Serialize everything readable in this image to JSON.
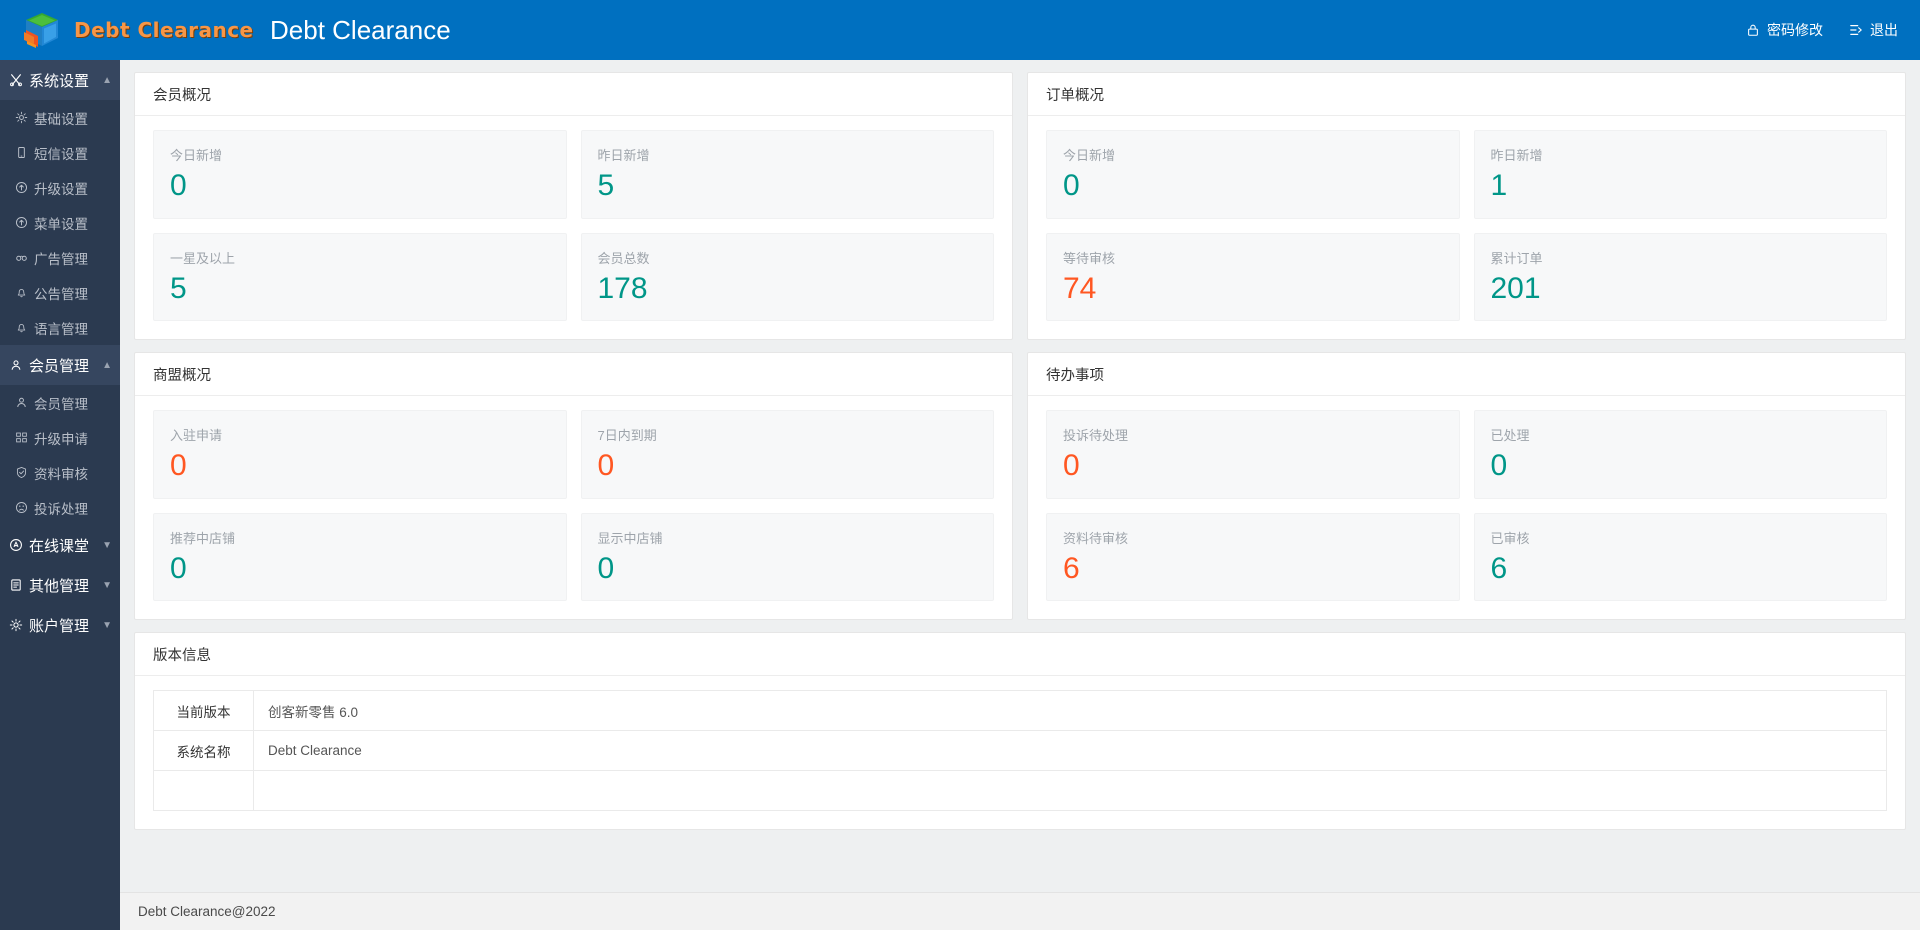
{
  "header": {
    "brand_word": "Debt Clearance",
    "logo_icon": "cube-logo-icon",
    "page_title": "Debt Clearance",
    "links": [
      {
        "label": "密码修改",
        "icon": "lock-icon"
      },
      {
        "label": "退出",
        "icon": "logout-icon"
      }
    ]
  },
  "sidebar": {
    "groups": [
      {
        "label": "系统设置",
        "icon": "scissors-icon",
        "expanded": true,
        "active": true,
        "chevron": "▲",
        "items": [
          {
            "label": "基础设置",
            "icon": "gear-icon"
          },
          {
            "label": "短信设置",
            "icon": "mobile-icon"
          },
          {
            "label": "升级设置",
            "icon": "up-circle-icon"
          },
          {
            "label": "菜单设置",
            "icon": "up-circle-icon"
          },
          {
            "label": "广告管理",
            "icon": "link-icon"
          },
          {
            "label": "公告管理",
            "icon": "bell-icon"
          },
          {
            "label": "语言管理",
            "icon": "bell-icon"
          }
        ]
      },
      {
        "label": "会员管理",
        "icon": "user-badge-icon",
        "expanded": true,
        "active": true,
        "chevron": "▲",
        "items": [
          {
            "label": "会员管理",
            "icon": "user-icon"
          },
          {
            "label": "升级申请",
            "icon": "grid-icon"
          },
          {
            "label": "资料审核",
            "icon": "shield-check-icon"
          },
          {
            "label": "投诉处理",
            "icon": "frown-icon"
          }
        ]
      },
      {
        "label": "在线课堂",
        "icon": "compass-icon",
        "expanded": false,
        "active": false,
        "chevron": "▼",
        "items": []
      },
      {
        "label": "其他管理",
        "icon": "file-icon",
        "expanded": false,
        "active": false,
        "chevron": "▼",
        "items": []
      },
      {
        "label": "账户管理",
        "icon": "gear-icon",
        "expanded": false,
        "active": false,
        "chevron": "▼",
        "items": []
      }
    ]
  },
  "panels": {
    "member_overview": {
      "title": "会员概况",
      "cards": [
        {
          "label": "今日新增",
          "value": "0",
          "color": "teal"
        },
        {
          "label": "昨日新增",
          "value": "5",
          "color": "teal"
        },
        {
          "label": "一星及以上",
          "value": "5",
          "color": "teal"
        },
        {
          "label": "会员总数",
          "value": "178",
          "color": "teal"
        }
      ]
    },
    "order_overview": {
      "title": "订单概况",
      "cards": [
        {
          "label": "今日新增",
          "value": "0",
          "color": "teal"
        },
        {
          "label": "昨日新增",
          "value": "1",
          "color": "teal"
        },
        {
          "label": "等待审核",
          "value": "74",
          "color": "orange"
        },
        {
          "label": "累计订单",
          "value": "201",
          "color": "teal"
        }
      ]
    },
    "alliance_overview": {
      "title": "商盟概况",
      "cards": [
        {
          "label": "入驻申请",
          "value": "0",
          "color": "orange"
        },
        {
          "label": "7日内到期",
          "value": "0",
          "color": "orange"
        },
        {
          "label": "推荐中店铺",
          "value": "0",
          "color": "teal"
        },
        {
          "label": "显示中店铺",
          "value": "0",
          "color": "teal"
        }
      ]
    },
    "todo_items": {
      "title": "待办事项",
      "cards": [
        {
          "label": "投诉待处理",
          "value": "0",
          "color": "orange"
        },
        {
          "label": "已处理",
          "value": "0",
          "color": "teal"
        },
        {
          "label": "资料待审核",
          "value": "6",
          "color": "orange"
        },
        {
          "label": "已审核",
          "value": "6",
          "color": "teal"
        }
      ]
    },
    "version_info": {
      "title": "版本信息",
      "rows": [
        {
          "key": "当前版本",
          "value": "创客新零售 6.0"
        },
        {
          "key": "系统名称",
          "value": "Debt Clearance"
        },
        {
          "key": "",
          "value": ""
        }
      ]
    }
  },
  "footer": {
    "text": "Debt Clearance@2022"
  },
  "colors": {
    "header_blue": "#0070c0",
    "sidebar_navy": "#2b3a50",
    "teal": "#009688",
    "orange": "#ff5722",
    "brand_orange": "#f79646"
  }
}
